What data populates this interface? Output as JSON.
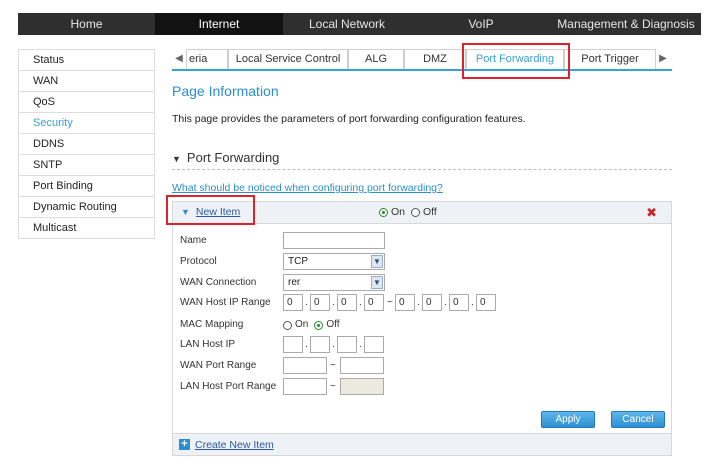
{
  "topnav": {
    "items": [
      {
        "label": "Home"
      },
      {
        "label": "Internet"
      },
      {
        "label": "Local Network"
      },
      {
        "label": "VoIP"
      },
      {
        "label": "Management & Diagnosis"
      }
    ],
    "active_index": 1
  },
  "sidebar": {
    "items": [
      {
        "label": "Status"
      },
      {
        "label": "WAN"
      },
      {
        "label": "QoS"
      },
      {
        "label": "Security"
      },
      {
        "label": "DDNS"
      },
      {
        "label": "SNTP"
      },
      {
        "label": "Port Binding"
      },
      {
        "label": "Dynamic Routing"
      },
      {
        "label": "Multicast"
      }
    ],
    "active_index": 3
  },
  "tabs": {
    "left_arrow": "◀",
    "right_arrow": "▶",
    "items": [
      {
        "label": "eria"
      },
      {
        "label": "Local Service Control"
      },
      {
        "label": "ALG"
      },
      {
        "label": "DMZ"
      },
      {
        "label": "Port Forwarding"
      },
      {
        "label": "Port Trigger"
      }
    ],
    "active_index": 4
  },
  "page": {
    "title": "Page Information",
    "description": "This page provides the parameters of port forwarding configuration features."
  },
  "section": {
    "title": "Port Forwarding",
    "notice_link": "What should be noticed when configuring port forwarding?"
  },
  "item": {
    "title": "New Item",
    "on_label": "On",
    "off_label": "Off",
    "enabled": "On",
    "delete_icon": "✖",
    "fields": {
      "name_label": "Name",
      "name_value": "",
      "protocol_label": "Protocol",
      "protocol_value": "TCP",
      "wan_conn_label": "WAN Connection",
      "wan_conn_value": "rer",
      "wan_ip_range_label": "WAN Host IP Range",
      "wan_ip_start": [
        "0",
        "0",
        "0",
        "0"
      ],
      "wan_ip_end": [
        "0",
        "0",
        "0",
        "0"
      ],
      "range_sep": "~",
      "dot_sep": ".",
      "mac_label": "MAC Mapping",
      "mac_on_label": "On",
      "mac_off_label": "Off",
      "mac_value": "Off",
      "lan_ip_label": "LAN Host IP",
      "lan_ip": [
        "",
        "",
        "",
        ""
      ],
      "wan_port_label": "WAN Port Range",
      "wan_port_start": "",
      "wan_port_end": "",
      "lan_port_label": "LAN Host Port Range",
      "lan_port_start": "",
      "lan_port_end": ""
    },
    "apply_label": "Apply",
    "cancel_label": "Cancel",
    "create_label": "Create New Item",
    "plus_icon": "+"
  },
  "colors": {
    "accent": "#2a8ecf",
    "highlight": "#e0202a",
    "nav_bg": "#2f2f2f"
  }
}
